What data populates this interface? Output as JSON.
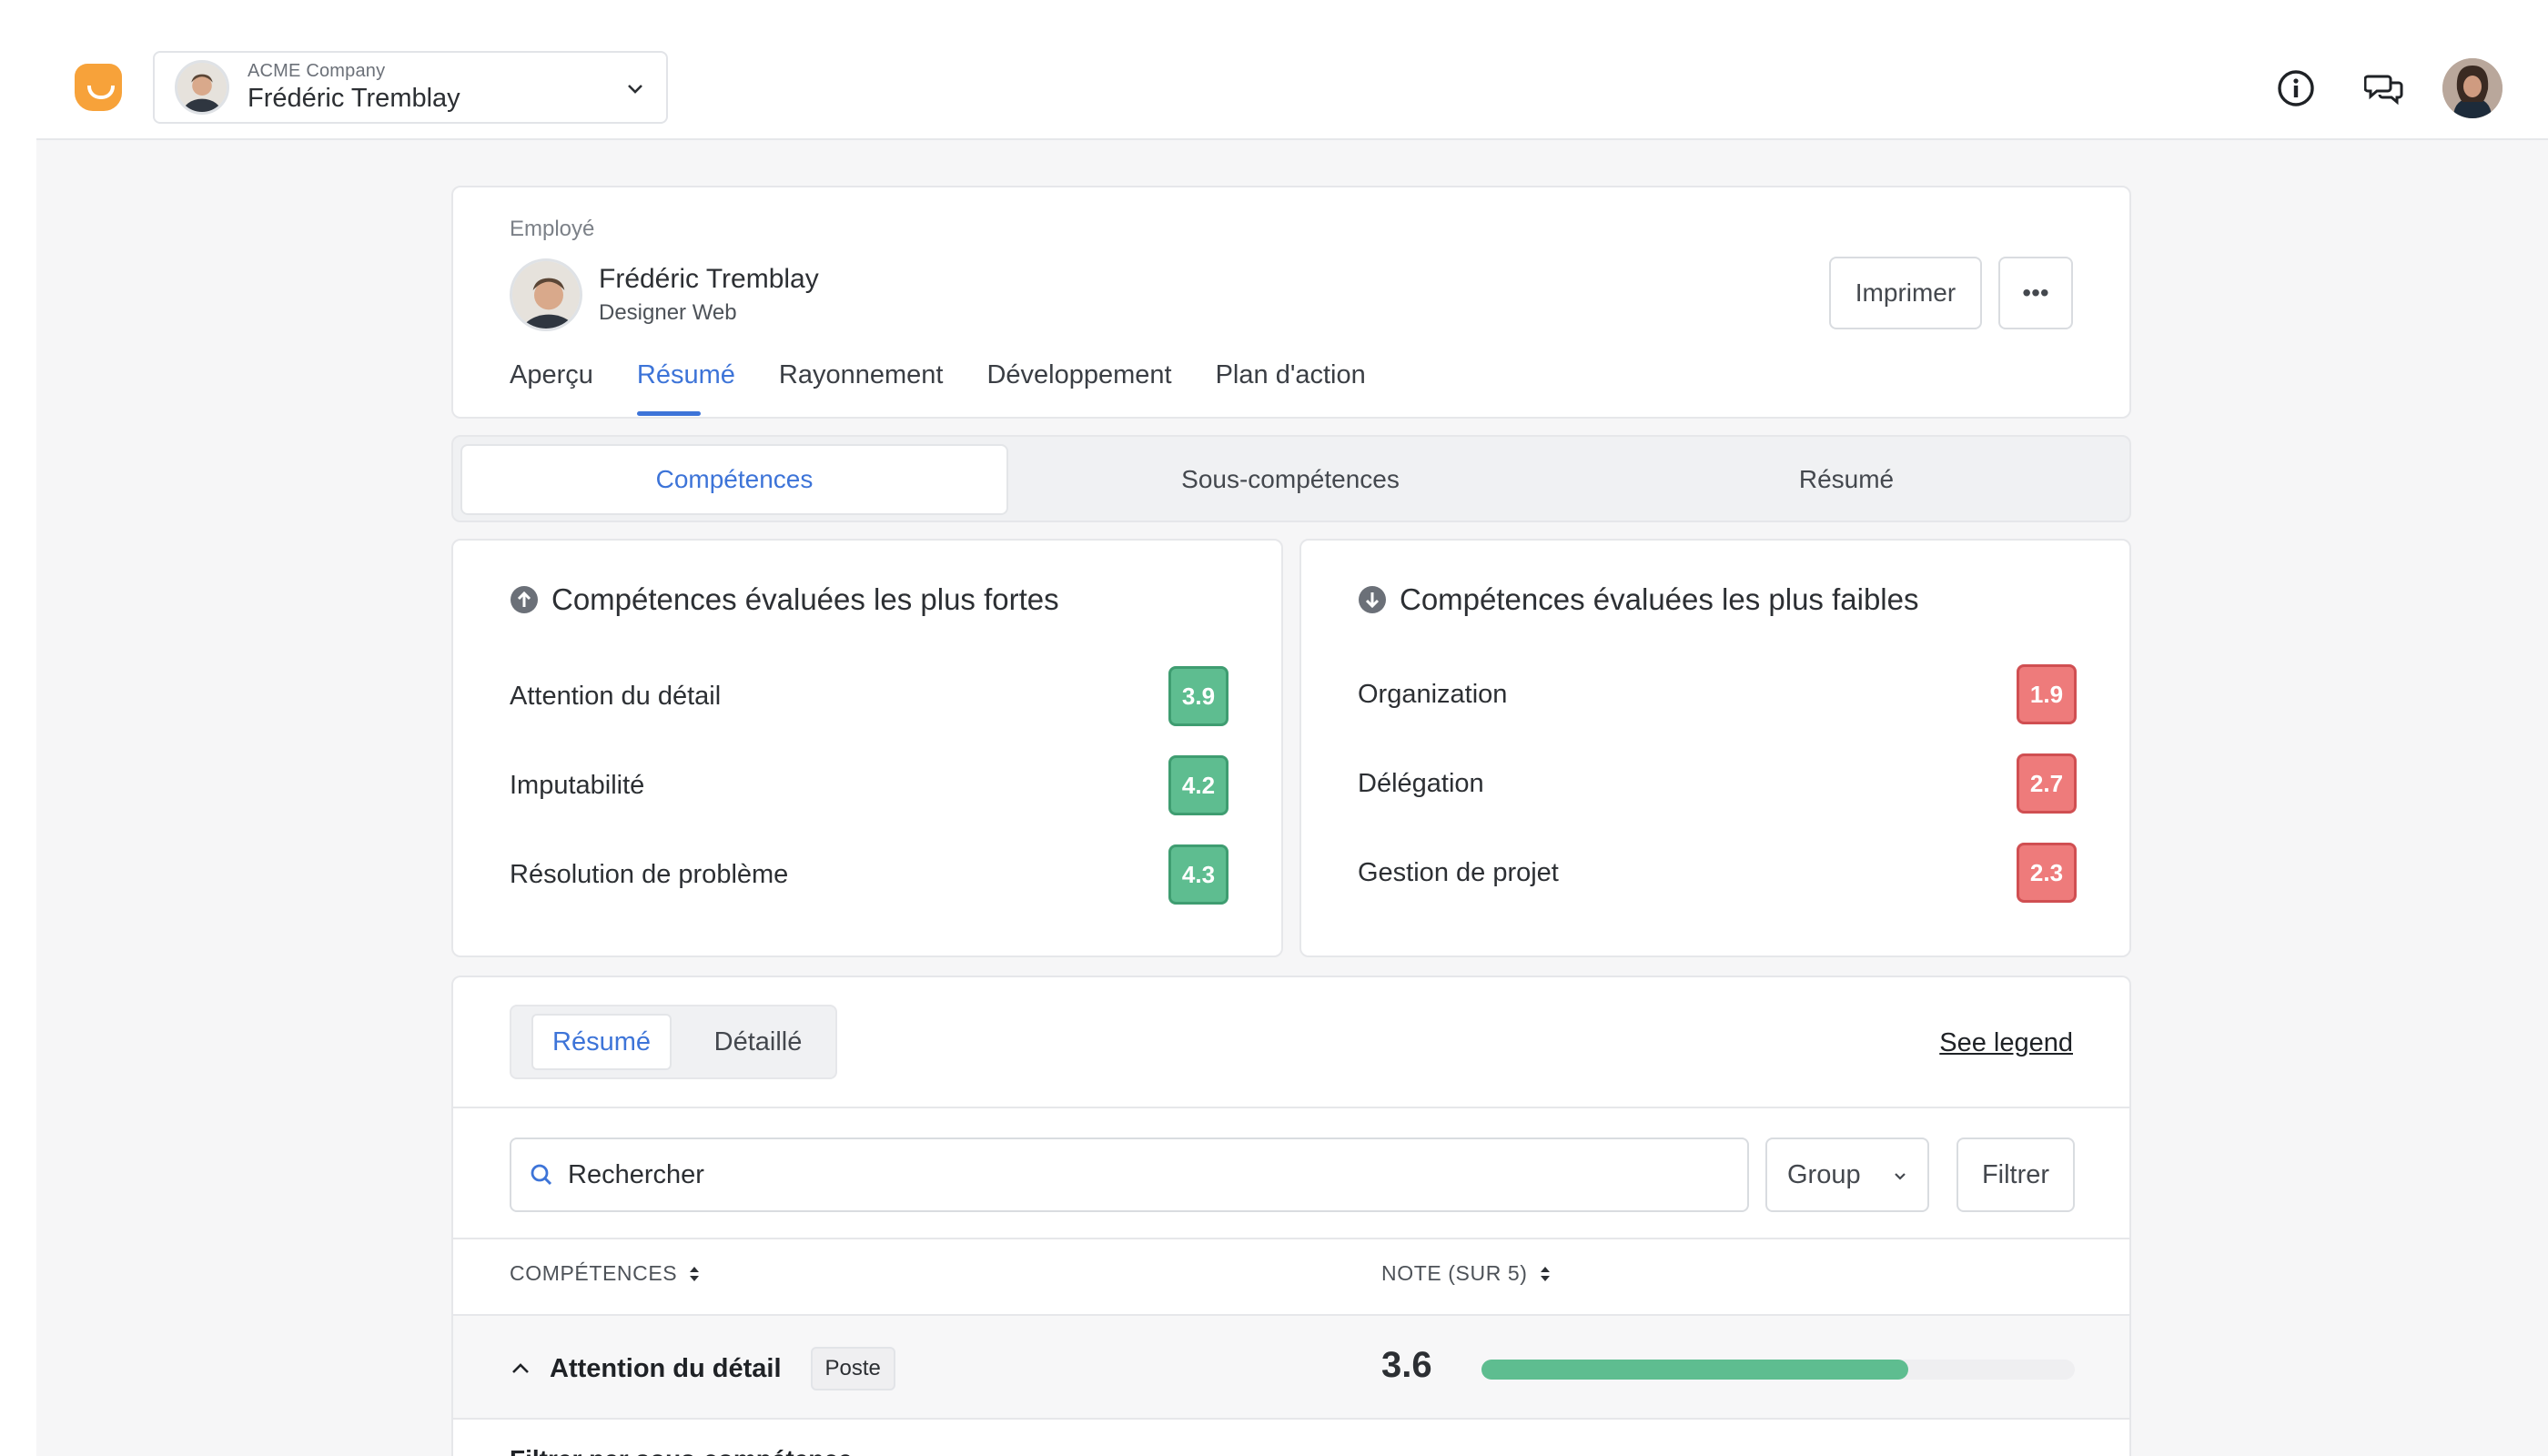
{
  "header": {
    "company": "ACME Company",
    "user": "Frédéric Tremblay"
  },
  "employee": {
    "label": "Employé",
    "name": "Frédéric Tremblay",
    "role": "Designer Web",
    "print_label": "Imprimer",
    "more_label": "•••"
  },
  "tabs": [
    {
      "label": "Aperçu"
    },
    {
      "label": "Résumé"
    },
    {
      "label": "Rayonnement"
    },
    {
      "label": "Développement"
    },
    {
      "label": "Plan d'action"
    }
  ],
  "segments": [
    {
      "label": "Compétences"
    },
    {
      "label": "Sous-compétences"
    },
    {
      "label": "Résumé"
    }
  ],
  "strongest": {
    "title": "Compétences évaluées les plus fortes",
    "items": [
      {
        "label": "Attention du détail",
        "score": "3.9"
      },
      {
        "label": "Imputabilité",
        "score": "4.2"
      },
      {
        "label": "Résolution de problème",
        "score": "4.3"
      }
    ]
  },
  "weakest": {
    "title": "Compétences évaluées les plus faibles",
    "items": [
      {
        "label": "Organization",
        "score": "1.9"
      },
      {
        "label": "Délégation",
        "score": "2.7"
      },
      {
        "label": "Gestion de projet",
        "score": "2.3"
      }
    ]
  },
  "detail": {
    "toggle_summary": "Résumé",
    "toggle_detailed": "Détaillé",
    "legend_link": "See legend",
    "search_placeholder": "Rechercher",
    "group_label": "Group",
    "filter_label": "Filtrer",
    "col_skills": "COMPÉTENCES",
    "col_score": "NOTE (SUR 5)",
    "row": {
      "name": "Attention du détail",
      "badge": "Poste",
      "score": "3.6",
      "score_fraction": 0.72
    },
    "sub_filter_label": "Filtrer par sous-compétence"
  },
  "colors": {
    "accent": "#3d74d8",
    "good": "#5ebd90",
    "bad": "#ee7b7b",
    "brand": "#f7a23a"
  },
  "icons": [
    "logo-icon",
    "chevron-down-icon",
    "info-icon",
    "chat-icon",
    "arrow-up-circle-icon",
    "arrow-down-circle-icon",
    "search-icon",
    "sort-icon",
    "chevron-up-icon"
  ]
}
